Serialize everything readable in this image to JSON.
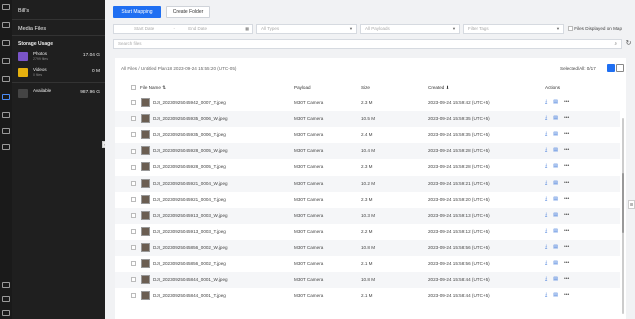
{
  "sidebar": {
    "header": "Bill's",
    "title": "Media Files",
    "storage_title": "Storage Usage",
    "storage": [
      {
        "name": "Photos",
        "sub": "2799 files",
        "size": "17.04 G",
        "icon": "photos-icon",
        "color": "#7a54c8"
      },
      {
        "name": "Videos",
        "sub": "0 files",
        "size": "0 M",
        "icon": "videos-icon",
        "color": "#e6b10f"
      },
      {
        "name": "Available",
        "sub": "",
        "size": "987.96 G",
        "icon": "available-icon",
        "color": "#444"
      }
    ]
  },
  "toolbar": {
    "start_mapping": "Start Mapping",
    "create_folder": "Create Folder",
    "start_date": "Start Date",
    "date_sep": "-",
    "end_date": "End Date",
    "all_types": "All Types",
    "all_payloads": "All Payloads",
    "filter_tags": "Filter Tags",
    "files_on_map": "Files Displayed on Map",
    "search_placeholder": "Search files"
  },
  "content": {
    "breadcrumb": "All Files  /  Untitled Plan18 2023-09-24 15:55:20 (UTC-05)",
    "selected": "Selected/All: 0/17",
    "columns": {
      "file_name": "File Name ⇅",
      "payload": "Payload",
      "size": "Size",
      "created": "Created ⬇",
      "actions": "Actions"
    },
    "rows": [
      {
        "name": "DJI_20230925045942_0007_T.jpeg",
        "payload": "M30T Camera",
        "size": "2.3 M",
        "created": "2023-09-24 15:59:42 (UTC+5)"
      },
      {
        "name": "DJI_20230925045935_0006_W.jpeg",
        "payload": "M30T Camera",
        "size": "10.5 M",
        "created": "2023-09-24 15:59:35 (UTC+5)"
      },
      {
        "name": "DJI_20230925045935_0006_T.jpeg",
        "payload": "M30T Camera",
        "size": "2.4 M",
        "created": "2023-09-24 15:59:35 (UTC+5)"
      },
      {
        "name": "DJI_20230925045928_0005_W.jpeg",
        "payload": "M30T Camera",
        "size": "10.4 M",
        "created": "2023-09-24 15:59:28 (UTC+5)"
      },
      {
        "name": "DJI_20230925045928_0005_T.jpeg",
        "payload": "M30T Camera",
        "size": "2.3 M",
        "created": "2023-09-24 15:59:28 (UTC+5)"
      },
      {
        "name": "DJI_20230925045921_0004_W.jpeg",
        "payload": "M30T Camera",
        "size": "10.2 M",
        "created": "2023-09-24 15:59:21 (UTC+5)"
      },
      {
        "name": "DJI_20230925045921_0004_T.jpeg",
        "payload": "M30T Camera",
        "size": "2.3 M",
        "created": "2023-09-24 15:59:20 (UTC+5)"
      },
      {
        "name": "DJI_20230925045913_0003_W.jpeg",
        "payload": "M30T Camera",
        "size": "10.3 M",
        "created": "2023-09-24 15:59:13 (UTC+5)"
      },
      {
        "name": "DJI_20230925045913_0003_T.jpeg",
        "payload": "M30T Camera",
        "size": "2.2 M",
        "created": "2023-09-24 15:59:12 (UTC+5)"
      },
      {
        "name": "DJI_20230925045856_0002_W.jpeg",
        "payload": "M30T Camera",
        "size": "10.8 M",
        "created": "2023-09-24 15:58:56 (UTC+5)"
      },
      {
        "name": "DJI_20230925045856_0002_T.jpeg",
        "payload": "M30T Camera",
        "size": "2.1 M",
        "created": "2023-09-24 15:58:56 (UTC+5)"
      },
      {
        "name": "DJI_20230925045844_0001_W.jpeg",
        "payload": "M30T Camera",
        "size": "10.8 M",
        "created": "2023-09-24 15:58:44 (UTC+5)"
      },
      {
        "name": "DJI_20230925045844_0001_T.jpeg",
        "payload": "M30T Camera",
        "size": "2.1 M",
        "created": "2023-09-24 15:58:44 (UTC+5)"
      }
    ]
  },
  "colors": {
    "accent": "#1f6ff2",
    "sidebar_bg": "#1f1f1f",
    "rail_bg": "#1a1a1a"
  }
}
